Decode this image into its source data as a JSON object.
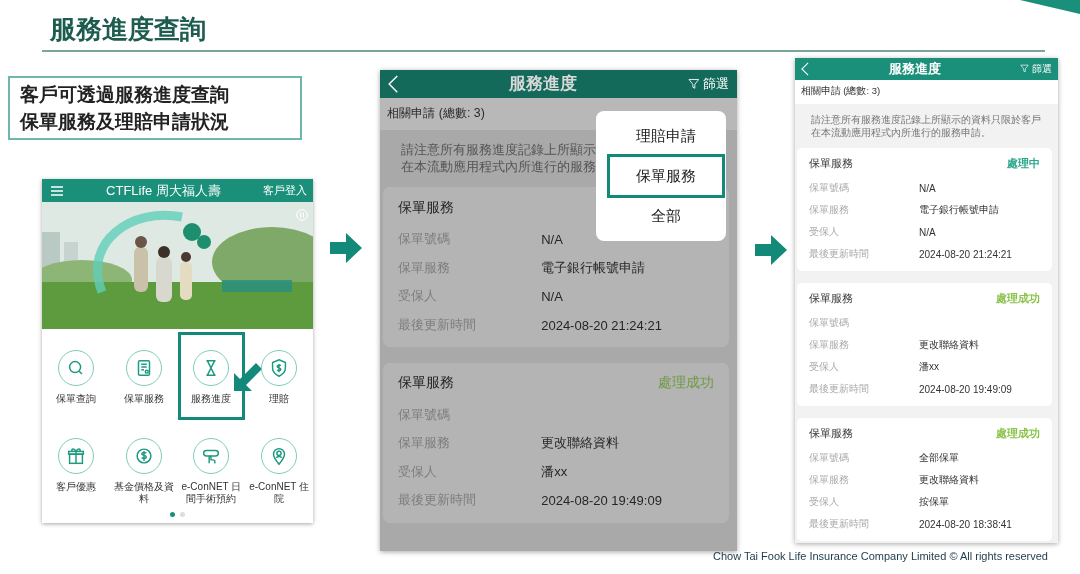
{
  "slide": {
    "title": "服務進度查詢",
    "callout": [
      "客戶可透過服務進度查詢",
      "保單服務及理賠申請狀況"
    ],
    "footer": "Chow Tai Fook Life Insurance Company Limited © All rights reserved"
  },
  "home_screen": {
    "brand": "CTFLife 周大福人壽",
    "login": "客戶登入",
    "menu": [
      {
        "label": "保單查詢",
        "highlighted": false
      },
      {
        "label": "保單服務",
        "highlighted": false
      },
      {
        "label": "服務進度",
        "highlighted": true
      },
      {
        "label": "理賠",
        "highlighted": false
      },
      {
        "label": "客戶優惠",
        "highlighted": false
      },
      {
        "label": "基金價格及資料",
        "highlighted": false
      },
      {
        "label": "e-ConNET 日間手術預約",
        "highlighted": false
      },
      {
        "label": "e-ConNET 住院",
        "highlighted": false
      }
    ],
    "pages": [
      {
        "selected": true
      },
      {
        "selected": false
      }
    ]
  },
  "filter_screen": {
    "title": "服務進度",
    "filter": "篩選",
    "count": "相關申請 (總數: 3)",
    "dimmed": true,
    "notice": [
      "請注意所有服務進度記錄上所顯示",
      "在本流動應用程式內所進行的服務"
    ],
    "cards": [
      {
        "title": "保單服務",
        "rows": [
          {
            "label": "保單號碼",
            "value": "N/A"
          },
          {
            "label": "保單服務",
            "value": "電子銀行帳號申請"
          },
          {
            "label": "受保人",
            "value": "N/A"
          },
          {
            "label": "最後更新時間",
            "value": "2024-08-20 21:24:21"
          }
        ]
      },
      {
        "title": "保單服務",
        "status": "處理成功",
        "color": "#6f9a45",
        "rows": [
          {
            "label": "保單號碼"
          },
          {
            "label": "保單服務",
            "value": "更改聯絡資料"
          },
          {
            "label": "受保人",
            "value": "潘xx"
          },
          {
            "label": "最後更新時間",
            "value": "2024-08-20 19:49:09"
          }
        ]
      }
    ],
    "menu": [
      {
        "label": "理賠申請",
        "selected": false
      },
      {
        "label": "保單服務",
        "selected": true
      },
      {
        "label": "全部",
        "selected": false
      }
    ]
  },
  "result_screen": {
    "title": "服務進度",
    "filter": "篩選",
    "count": "相關申請 (總數: 3)",
    "notice": [
      "請注意所有服務進度記錄上所顯示的資料只限於客戶",
      "在本流動應用程式內所進行的服務申請。"
    ],
    "cards": [
      {
        "title": "保單服務",
        "status": "處理中",
        "color": "#2aa58a",
        "rows": [
          {
            "label": "保單號碼",
            "value": "N/A"
          },
          {
            "label": "保單服務",
            "value": "電子銀行帳號申請"
          },
          {
            "label": "受保人",
            "value": "N/A"
          },
          {
            "label": "最後更新時間",
            "value": "2024-08-20 21:24:21"
          }
        ]
      },
      {
        "title": "保單服務",
        "status": "處理成功",
        "color": "#8bc34a",
        "rows": [
          {
            "label": "保單號碼"
          },
          {
            "label": "保單服務",
            "value": "更改聯絡資料"
          },
          {
            "label": "受保人",
            "value": "潘xx"
          },
          {
            "label": "最後更新時間",
            "value": "2024-08-20 19:49:09"
          }
        ]
      },
      {
        "title": "保單服務",
        "status": "處理成功",
        "color": "#8bc34a",
        "rows": [
          {
            "label": "保單號碼",
            "value": "全部保單"
          },
          {
            "label": "保單服務",
            "value": "更改聯絡資料"
          },
          {
            "label": "受保人",
            "value": "按保單"
          },
          {
            "label": "最後更新時間",
            "value": "2024-08-20 18:38:41"
          }
        ]
      }
    ]
  }
}
